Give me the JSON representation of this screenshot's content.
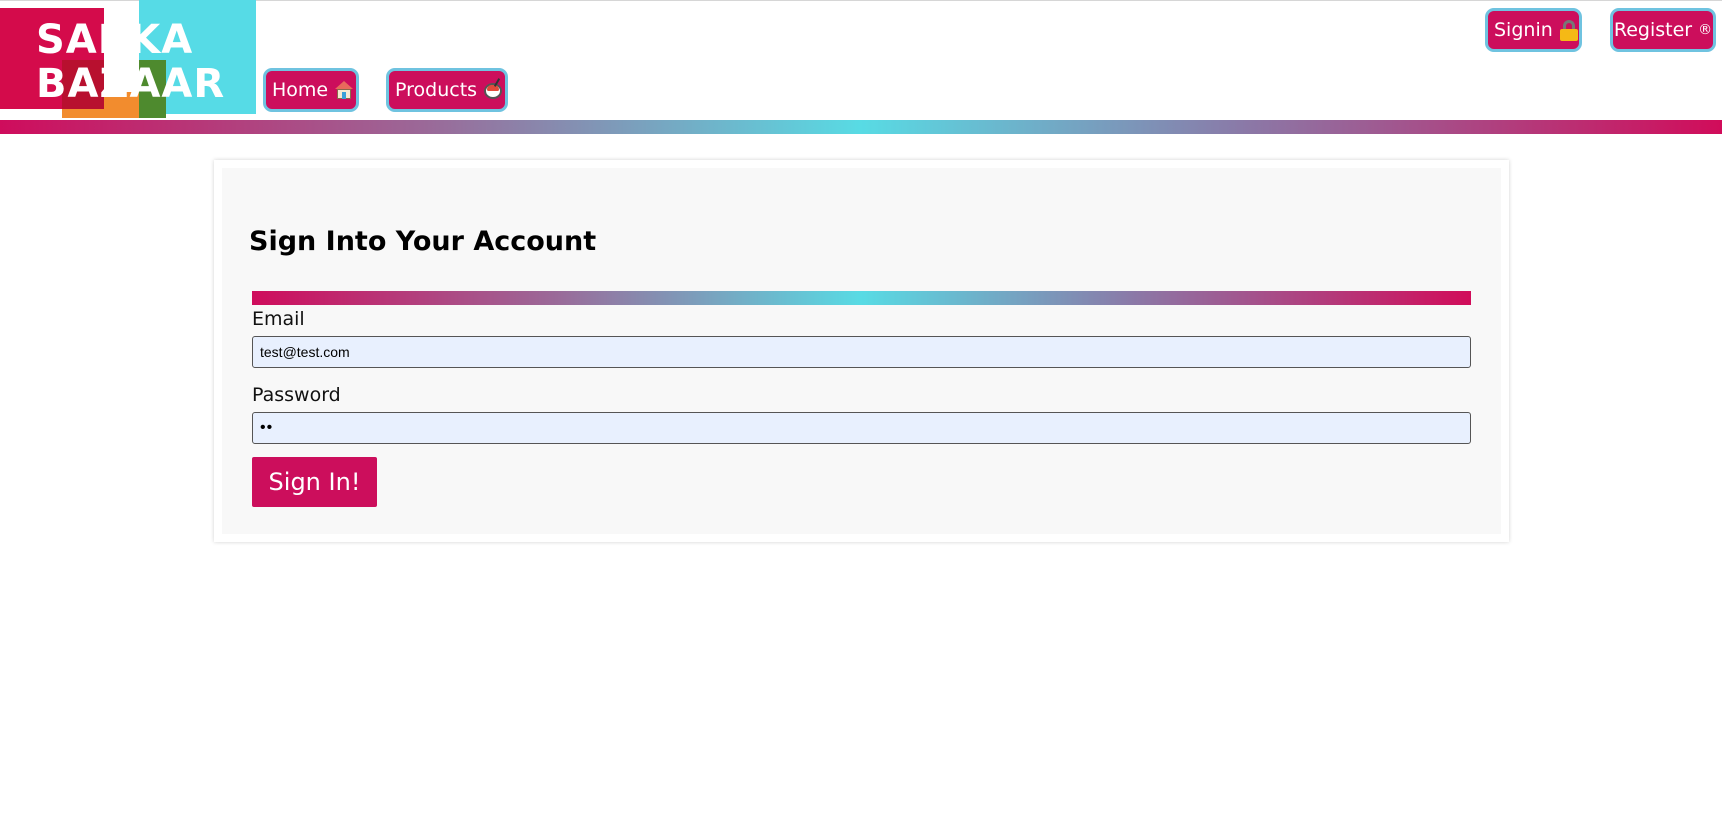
{
  "brand": {
    "logo_line1": "SABKA",
    "logo_line2": "BAZAAR"
  },
  "nav": {
    "home_label": "Home",
    "home_icon": "house-icon",
    "products_label": "Products",
    "products_icon": "bowl-icon",
    "signin_label": "Signin",
    "signin_icon": "lock-icon",
    "register_label": "Register",
    "register_symbol": "®"
  },
  "form": {
    "title": "Sign Into Your Account",
    "email_label": "Email",
    "email_value": "test@test.com",
    "password_label": "Password",
    "password_value": "12",
    "submit_label": "Sign In!"
  },
  "colors": {
    "primary": "#cc0e5c",
    "accent_cyan": "#56dbe6",
    "pill_border": "#6fc3e0",
    "input_bg": "#e8f0fe"
  }
}
